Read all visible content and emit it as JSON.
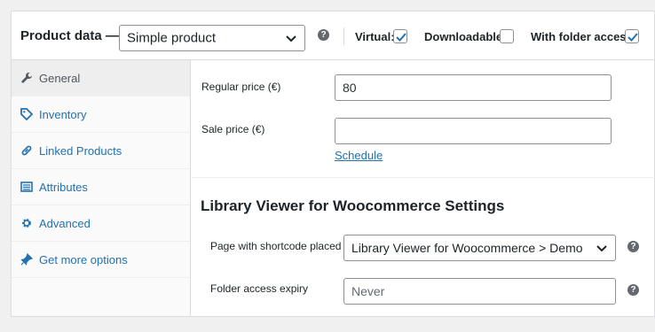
{
  "header": {
    "title": "Product data —",
    "product_type": "Simple product",
    "help": "?",
    "options": {
      "virtual": {
        "label": "Virtual:",
        "checked": true
      },
      "downloadable": {
        "label": "Downloadable:",
        "checked": false
      },
      "folder_access": {
        "label": "With folder access:",
        "checked": true
      }
    }
  },
  "sidebar": {
    "tabs": [
      {
        "label": "General",
        "icon": "wrench-icon",
        "active": true
      },
      {
        "label": "Inventory",
        "icon": "tag-icon"
      },
      {
        "label": "Linked Products",
        "icon": "link-icon"
      },
      {
        "label": "Attributes",
        "icon": "list-icon"
      },
      {
        "label": "Advanced",
        "icon": "gear-icon"
      },
      {
        "label": "Get more options",
        "icon": "pin-icon"
      }
    ]
  },
  "general": {
    "regular_price": {
      "label": "Regular price (€)",
      "value": "80"
    },
    "sale_price": {
      "label": "Sale price (€)",
      "value": ""
    },
    "schedule_link": "Schedule"
  },
  "library_viewer": {
    "title": "Library Viewer for Woocommerce Settings",
    "page_shortcode": {
      "label": "Page with shortcode placed",
      "value": "Library Viewer for Woocommerce > Demo"
    },
    "folder_expiry": {
      "label": "Folder access expiry",
      "placeholder": "Never"
    },
    "help": "?"
  },
  "colors": {
    "accent": "#2271b1",
    "text": "#1d2327",
    "border": "#8c8f94"
  }
}
